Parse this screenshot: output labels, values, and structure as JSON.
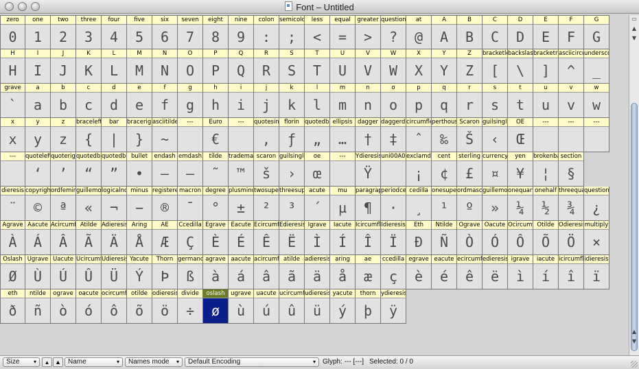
{
  "window": {
    "title": "Font – Untitled"
  },
  "toolbar": {
    "size_label": "Size",
    "name_select": "Name",
    "mode_select": "Names mode",
    "encoding_select": "Default Encoding",
    "glyph_status": "Glyph: --- [---]",
    "selected_status": "Selected: 0 / 0",
    "btn1_icon": "mountain-small-icon",
    "btn2_icon": "mountain-large-icon"
  },
  "selected_cell": 208,
  "glyphs": [
    {
      "n": "zero",
      "g": "0"
    },
    {
      "n": "one",
      "g": "1"
    },
    {
      "n": "two",
      "g": "2"
    },
    {
      "n": "three",
      "g": "3"
    },
    {
      "n": "four",
      "g": "4"
    },
    {
      "n": "five",
      "g": "5"
    },
    {
      "n": "six",
      "g": "6"
    },
    {
      "n": "seven",
      "g": "7"
    },
    {
      "n": "eight",
      "g": "8"
    },
    {
      "n": "nine",
      "g": "9"
    },
    {
      "n": "colon",
      "g": ":"
    },
    {
      "n": "semicolon",
      "g": ";"
    },
    {
      "n": "less",
      "g": "<"
    },
    {
      "n": "equal",
      "g": "="
    },
    {
      "n": "greater",
      "g": ">"
    },
    {
      "n": "question",
      "g": "?"
    },
    {
      "n": "at",
      "g": "@"
    },
    {
      "n": "A",
      "g": "A"
    },
    {
      "n": "B",
      "g": "B"
    },
    {
      "n": "C",
      "g": "C"
    },
    {
      "n": "D",
      "g": "D"
    },
    {
      "n": "E",
      "g": "E"
    },
    {
      "n": "F",
      "g": "F"
    },
    {
      "n": "G",
      "g": "G"
    },
    {
      "n": "",
      "g": ""
    },
    {
      "n": "H",
      "g": "H"
    },
    {
      "n": "I",
      "g": "I"
    },
    {
      "n": "J",
      "g": "J"
    },
    {
      "n": "K",
      "g": "K"
    },
    {
      "n": "L",
      "g": "L"
    },
    {
      "n": "M",
      "g": "M"
    },
    {
      "n": "N",
      "g": "N"
    },
    {
      "n": "O",
      "g": "O"
    },
    {
      "n": "P",
      "g": "P"
    },
    {
      "n": "Q",
      "g": "Q"
    },
    {
      "n": "R",
      "g": "R"
    },
    {
      "n": "S",
      "g": "S"
    },
    {
      "n": "T",
      "g": "T"
    },
    {
      "n": "U",
      "g": "U"
    },
    {
      "n": "V",
      "g": "V"
    },
    {
      "n": "W",
      "g": "W"
    },
    {
      "n": "X",
      "g": "X"
    },
    {
      "n": "Y",
      "g": "Y"
    },
    {
      "n": "Z",
      "g": "Z"
    },
    {
      "n": "bracketleft",
      "g": "["
    },
    {
      "n": "backslash",
      "g": "\\"
    },
    {
      "n": "bracketright",
      "g": "]"
    },
    {
      "n": "asciicircum",
      "g": "^"
    },
    {
      "n": "underscore",
      "g": "_"
    },
    {
      "n": "",
      "g": ""
    },
    {
      "n": "grave",
      "g": "`"
    },
    {
      "n": "a",
      "g": "a"
    },
    {
      "n": "b",
      "g": "b"
    },
    {
      "n": "c",
      "g": "c"
    },
    {
      "n": "d",
      "g": "d"
    },
    {
      "n": "e",
      "g": "e"
    },
    {
      "n": "f",
      "g": "f"
    },
    {
      "n": "g",
      "g": "g"
    },
    {
      "n": "h",
      "g": "h"
    },
    {
      "n": "i",
      "g": "i"
    },
    {
      "n": "j",
      "g": "j"
    },
    {
      "n": "k",
      "g": "k"
    },
    {
      "n": "l",
      "g": "l"
    },
    {
      "n": "m",
      "g": "m"
    },
    {
      "n": "n",
      "g": "n"
    },
    {
      "n": "o",
      "g": "o"
    },
    {
      "n": "p",
      "g": "p"
    },
    {
      "n": "q",
      "g": "q"
    },
    {
      "n": "r",
      "g": "r"
    },
    {
      "n": "s",
      "g": "s"
    },
    {
      "n": "t",
      "g": "t"
    },
    {
      "n": "u",
      "g": "u"
    },
    {
      "n": "v",
      "g": "v"
    },
    {
      "n": "w",
      "g": "w"
    },
    {
      "n": "",
      "g": ""
    },
    {
      "n": "x",
      "g": "x"
    },
    {
      "n": "y",
      "g": "y"
    },
    {
      "n": "z",
      "g": "z"
    },
    {
      "n": "braceleft",
      "g": "{"
    },
    {
      "n": "bar",
      "g": "|"
    },
    {
      "n": "braceright",
      "g": "}"
    },
    {
      "n": "asciitilde",
      "g": "~"
    },
    {
      "n": "---",
      "g": ""
    },
    {
      "n": "Euro",
      "g": "€"
    },
    {
      "n": "---",
      "g": ""
    },
    {
      "n": "quotesinglbase",
      "g": "‚"
    },
    {
      "n": "florin",
      "g": "ƒ"
    },
    {
      "n": "quotedblbase",
      "g": "„"
    },
    {
      "n": "ellipsis",
      "g": "…"
    },
    {
      "n": "dagger",
      "g": "†"
    },
    {
      "n": "daggerdbl",
      "g": "‡"
    },
    {
      "n": "circumflex",
      "g": "ˆ"
    },
    {
      "n": "perthousand",
      "g": "‰"
    },
    {
      "n": "Scaron",
      "g": "Š"
    },
    {
      "n": "guilsinglleft",
      "g": "‹"
    },
    {
      "n": "OE",
      "g": "Œ"
    },
    {
      "n": "---",
      "g": ""
    },
    {
      "n": "---",
      "g": ""
    },
    {
      "n": "---",
      "g": ""
    },
    {
      "n": "",
      "g": ""
    },
    {
      "n": "---",
      "g": ""
    },
    {
      "n": "quoteleft",
      "g": "‘"
    },
    {
      "n": "quoteright",
      "g": "’"
    },
    {
      "n": "quotedblleft",
      "g": "“"
    },
    {
      "n": "quotedblright",
      "g": "”"
    },
    {
      "n": "bullet",
      "g": "•"
    },
    {
      "n": "endash",
      "g": "–"
    },
    {
      "n": "emdash",
      "g": "—"
    },
    {
      "n": "tilde",
      "g": "˜"
    },
    {
      "n": "trademark",
      "g": "™"
    },
    {
      "n": "scaron",
      "g": "š"
    },
    {
      "n": "guilsinglright",
      "g": "›"
    },
    {
      "n": "oe",
      "g": "œ"
    },
    {
      "n": "---",
      "g": ""
    },
    {
      "n": "Ydieresis",
      "g": "Ÿ"
    },
    {
      "n": "uni00A0",
      "g": ""
    },
    {
      "n": "exclamdown",
      "g": "¡"
    },
    {
      "n": "cent",
      "g": "¢"
    },
    {
      "n": "sterling",
      "g": "£"
    },
    {
      "n": "currency",
      "g": "¤"
    },
    {
      "n": "yen",
      "g": "¥"
    },
    {
      "n": "brokenbar",
      "g": "¦"
    },
    {
      "n": "section",
      "g": "§"
    },
    {
      "n": "",
      "g": ""
    },
    {
      "n": "",
      "g": ""
    },
    {
      "n": "dieresis",
      "g": "¨"
    },
    {
      "n": "copyright",
      "g": "©"
    },
    {
      "n": "ordfeminine",
      "g": "ª"
    },
    {
      "n": "guillemotleft",
      "g": "«"
    },
    {
      "n": "logicalnot",
      "g": "¬"
    },
    {
      "n": "minus",
      "g": "−"
    },
    {
      "n": "registered",
      "g": "®"
    },
    {
      "n": "macron",
      "g": "¯"
    },
    {
      "n": "degree",
      "g": "°"
    },
    {
      "n": "plusminus",
      "g": "±"
    },
    {
      "n": "twosuperior",
      "g": "²"
    },
    {
      "n": "threesuperior",
      "g": "³"
    },
    {
      "n": "acute",
      "g": "´"
    },
    {
      "n": "mu",
      "g": "µ"
    },
    {
      "n": "paragraph",
      "g": "¶"
    },
    {
      "n": "periodcentered",
      "g": "·"
    },
    {
      "n": "cedilla",
      "g": "¸"
    },
    {
      "n": "onesuperior",
      "g": "¹"
    },
    {
      "n": "ordmasculine",
      "g": "º"
    },
    {
      "n": "guillemotright",
      "g": "»"
    },
    {
      "n": "onequarter",
      "g": "¼"
    },
    {
      "n": "onehalf",
      "g": "½"
    },
    {
      "n": "threequarters",
      "g": "¾"
    },
    {
      "n": "questiondown",
      "g": "¿"
    },
    {
      "n": "",
      "g": ""
    },
    {
      "n": "Agrave",
      "g": "À"
    },
    {
      "n": "Aacute",
      "g": "Á"
    },
    {
      "n": "Acircumflex",
      "g": "Â"
    },
    {
      "n": "Atilde",
      "g": "Ã"
    },
    {
      "n": "Adieresis",
      "g": "Ä"
    },
    {
      "n": "Aring",
      "g": "Å"
    },
    {
      "n": "AE",
      "g": "Æ"
    },
    {
      "n": "Ccedilla",
      "g": "Ç"
    },
    {
      "n": "Egrave",
      "g": "È"
    },
    {
      "n": "Eacute",
      "g": "É"
    },
    {
      "n": "Ecircumflex",
      "g": "Ê"
    },
    {
      "n": "Edieresis",
      "g": "Ë"
    },
    {
      "n": "Igrave",
      "g": "Ì"
    },
    {
      "n": "Iacute",
      "g": "Í"
    },
    {
      "n": "Icircumflex",
      "g": "Î"
    },
    {
      "n": "Idieresis",
      "g": "Ï"
    },
    {
      "n": "Eth",
      "g": "Ð"
    },
    {
      "n": "Ntilde",
      "g": "Ñ"
    },
    {
      "n": "Ograve",
      "g": "Ò"
    },
    {
      "n": "Oacute",
      "g": "Ó"
    },
    {
      "n": "Ocircumflex",
      "g": "Ô"
    },
    {
      "n": "Otilde",
      "g": "Õ"
    },
    {
      "n": "Odieresis",
      "g": "Ö"
    },
    {
      "n": "multiply",
      "g": "×"
    },
    {
      "n": "",
      "g": ""
    },
    {
      "n": "Oslash",
      "g": "Ø"
    },
    {
      "n": "Ugrave",
      "g": "Ù"
    },
    {
      "n": "Uacute",
      "g": "Ú"
    },
    {
      "n": "Ucircumflex",
      "g": "Û"
    },
    {
      "n": "Udieresis",
      "g": "Ü"
    },
    {
      "n": "Yacute",
      "g": "Ý"
    },
    {
      "n": "Thorn",
      "g": "Þ"
    },
    {
      "n": "germandbls",
      "g": "ß"
    },
    {
      "n": "agrave",
      "g": "à"
    },
    {
      "n": "aacute",
      "g": "á"
    },
    {
      "n": "acircumflex",
      "g": "â"
    },
    {
      "n": "atilde",
      "g": "ã"
    },
    {
      "n": "adieresis",
      "g": "ä"
    },
    {
      "n": "aring",
      "g": "å"
    },
    {
      "n": "ae",
      "g": "æ"
    },
    {
      "n": "ccedilla",
      "g": "ç"
    },
    {
      "n": "egrave",
      "g": "è"
    },
    {
      "n": "eacute",
      "g": "é"
    },
    {
      "n": "ecircumflex",
      "g": "ê"
    },
    {
      "n": "edieresis",
      "g": "ë"
    },
    {
      "n": "igrave",
      "g": "ì"
    },
    {
      "n": "iacute",
      "g": "í"
    },
    {
      "n": "icircumflex",
      "g": "î"
    },
    {
      "n": "idieresis",
      "g": "ï"
    },
    {
      "n": "",
      "g": ""
    },
    {
      "n": "eth",
      "g": "ð"
    },
    {
      "n": "ntilde",
      "g": "ñ"
    },
    {
      "n": "ograve",
      "g": "ò"
    },
    {
      "n": "oacute",
      "g": "ó"
    },
    {
      "n": "ocircumflex",
      "g": "ô"
    },
    {
      "n": "otilde",
      "g": "õ"
    },
    {
      "n": "odieresis",
      "g": "ö"
    },
    {
      "n": "divide",
      "g": "÷"
    },
    {
      "n": "oslash",
      "g": "ø"
    },
    {
      "n": "ugrave",
      "g": "ù"
    },
    {
      "n": "uacute",
      "g": "ú"
    },
    {
      "n": "ucircumflex",
      "g": "û"
    },
    {
      "n": "udieresis",
      "g": "ü"
    },
    {
      "n": "yacute",
      "g": "ý"
    },
    {
      "n": "thorn",
      "g": "þ"
    },
    {
      "n": "ydieresis",
      "g": "ÿ"
    }
  ]
}
